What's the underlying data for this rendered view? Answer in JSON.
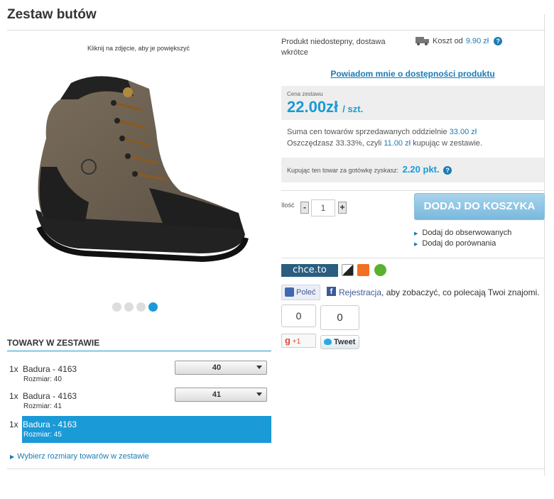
{
  "page": {
    "title": "Zestaw butów"
  },
  "gallery": {
    "hint": "Kliknij na zdjęcie, aby je powiększyć",
    "dots_total": 4,
    "active_dot": 4
  },
  "set": {
    "header": "TOWARY W ZESTAWIE",
    "items": [
      {
        "qty": "1x",
        "name": "Badura - 4163",
        "size_label": "Rozmiar: 40",
        "select_value": "40",
        "selected": false
      },
      {
        "qty": "1x",
        "name": "Badura - 4163",
        "size_label": "Rozmiar: 41",
        "select_value": "41",
        "selected": false
      },
      {
        "qty": "1x",
        "name": "Badura - 4163",
        "size_label": "Rozmiar: 45",
        "selected": true
      }
    ],
    "choose_sizes": "Wybierz rozmiary towarów w zestawie"
  },
  "availability": {
    "text": "Produkt niedostepny, dostawa wkrótce",
    "shipping_prefix": "Koszt od",
    "shipping_price": "9.90 zł",
    "help": "?"
  },
  "notify_link": "Powiadom mnie o dostępności produktu",
  "price": {
    "label": "Cena zestawu",
    "value": "22.00zł",
    "unit": "/ szt."
  },
  "savings": {
    "line1_prefix": "Suma cen towarów sprzedawanych oddzielnie",
    "line1_value": "33.00 zł",
    "line2_prefix": "Oszczędzasz 33.33%, czyli",
    "line2_value": "11.00 zł",
    "line2_suffix": "kupując w zestawie."
  },
  "points": {
    "text": "Kupując ten towar za gotówkę zyskasz:",
    "value": "2.20 pkt.",
    "help": "?"
  },
  "quantity": {
    "label": "Ilość",
    "minus": "-",
    "value": "1",
    "plus": "+"
  },
  "add_to_cart": "DODAJ DO KOSZYKA",
  "side_links": [
    "Dodaj do obserwowanych",
    "Dodaj do porównania"
  ],
  "social": {
    "chceto": "chce.to",
    "fb_like": "Poleć",
    "fb_register": "Rejestracja",
    "fb_text": ", aby zobaczyć, co polecają Twoi znajomi.",
    "gplus_count": "0",
    "gplus_label": "+1",
    "tweet_count": "0",
    "tweet_label": "Tweet"
  },
  "colors": {
    "accent": "#1a9ad6",
    "link": "#1a7bb5",
    "facebook": "#3b5998"
  }
}
